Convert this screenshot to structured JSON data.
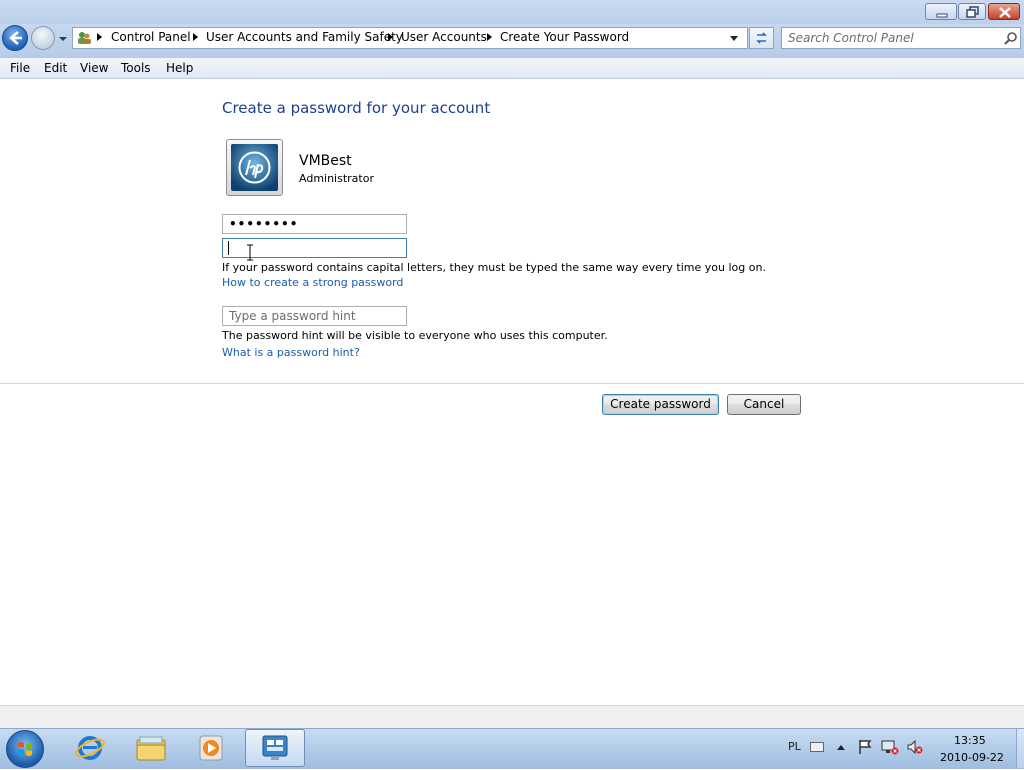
{
  "window": {
    "buttons": {
      "minimize": "minimize-icon",
      "maximize": "maximize-icon",
      "close": "close-icon"
    }
  },
  "navigation": {
    "breadcrumb": [
      "Control Panel",
      "User Accounts and Family Safety",
      "User Accounts",
      "Create Your Password"
    ],
    "search_placeholder": "Search Control Panel"
  },
  "menu": [
    "File",
    "Edit",
    "View",
    "Tools",
    "Help"
  ],
  "page": {
    "title": "Create a password for your account",
    "user": {
      "name": "VMBest",
      "role": "Administrator"
    },
    "new_password_value": "••••••••",
    "confirm_password_value": "",
    "caps_note": "If your password contains capital letters, they must be typed the same way every time you log on.",
    "strong_password_link": "How to create a strong password",
    "hint_placeholder": "Type a password hint",
    "hint_note": "The password hint will be visible to everyone who uses this computer.",
    "hint_link": "What is a password hint?",
    "create_button": "Create password",
    "cancel_button": "Cancel"
  },
  "taskbar": {
    "language": "PL",
    "time": "13:35",
    "date": "2010-09-22"
  },
  "colors": {
    "link": "#1a5dab",
    "title": "#1e3f8c",
    "accent": "#3c7fb1"
  }
}
